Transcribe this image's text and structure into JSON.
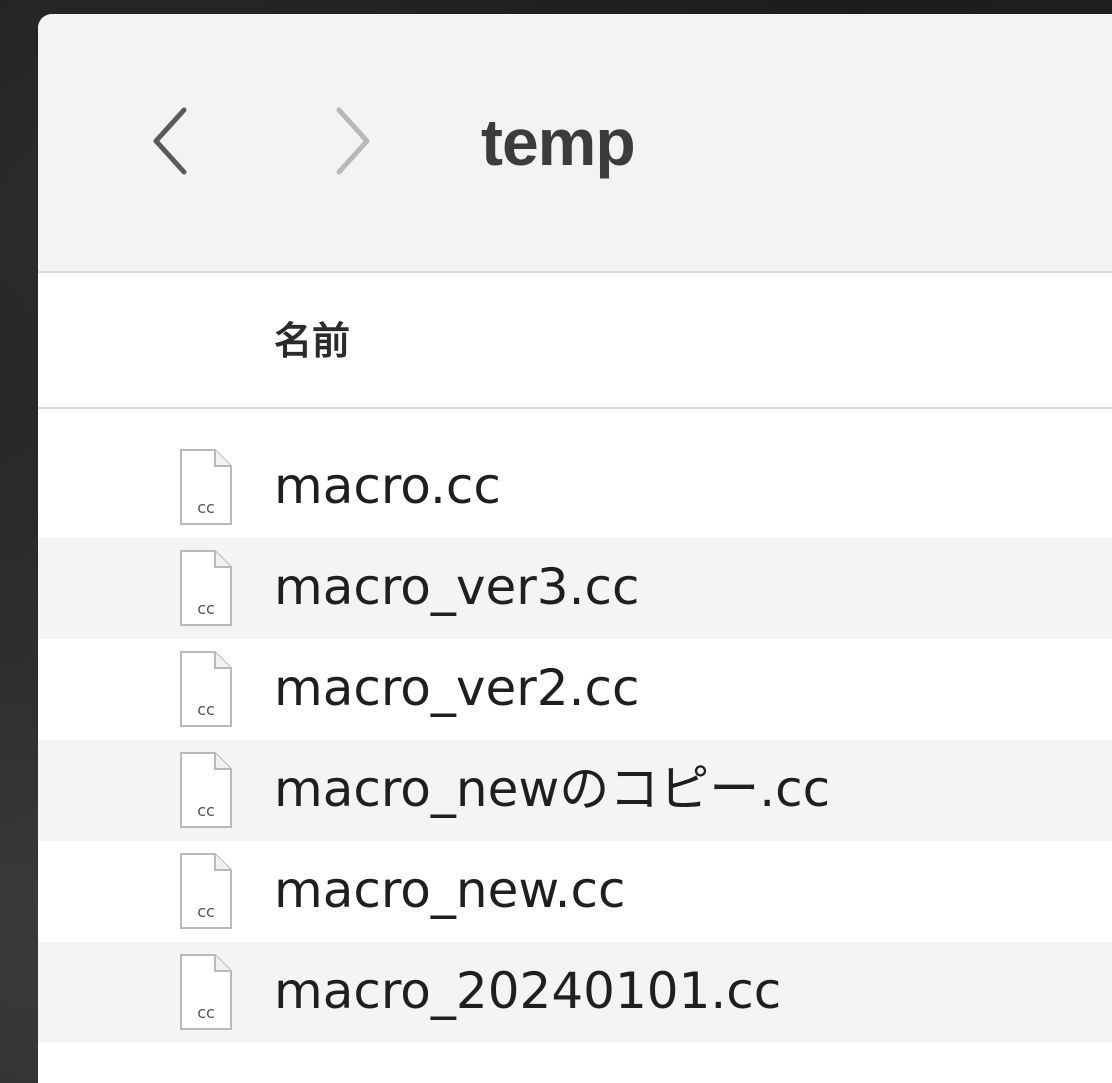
{
  "window": {
    "title": "temp"
  },
  "toolbar": {
    "back_icon": "chevron-left-icon",
    "forward_icon": "chevron-right-icon"
  },
  "columns": {
    "name_header": "名前"
  },
  "file_icon": {
    "name": "cc-document-icon",
    "label": "cc"
  },
  "files": [
    {
      "name": "macro.cc"
    },
    {
      "name": "macro_ver3.cc"
    },
    {
      "name": "macro_ver2.cc"
    },
    {
      "name": "macro_newのコピー.cc"
    },
    {
      "name": "macro_new.cc"
    },
    {
      "name": "macro_20240101.cc"
    }
  ],
  "colors": {
    "window_background": "#f2f3f3",
    "list_background": "#ffffff",
    "alternate_row": "#f3f4f4",
    "text": "#1f1f1f"
  }
}
